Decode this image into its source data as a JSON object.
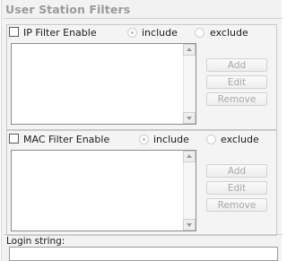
{
  "section_title": "User Station Filters",
  "ip_filter": {
    "checkbox_label": "IP Filter Enable",
    "include_label": "include",
    "exclude_label": "exclude",
    "include_selected": true,
    "buttons": {
      "add": "Add",
      "edit": "Edit",
      "remove": "Remove"
    }
  },
  "mac_filter": {
    "checkbox_label": "MAC Filter Enable",
    "include_label": "include",
    "exclude_label": "exclude",
    "include_selected": true,
    "buttons": {
      "add": "Add",
      "edit": "Edit",
      "remove": "Remove"
    }
  },
  "login_string": {
    "label": "Login string:",
    "value": ""
  },
  "colors": {
    "title": "#9a9a9a",
    "disabled_text": "#a8a8a8",
    "panel_bg": "#f2f2f2"
  }
}
